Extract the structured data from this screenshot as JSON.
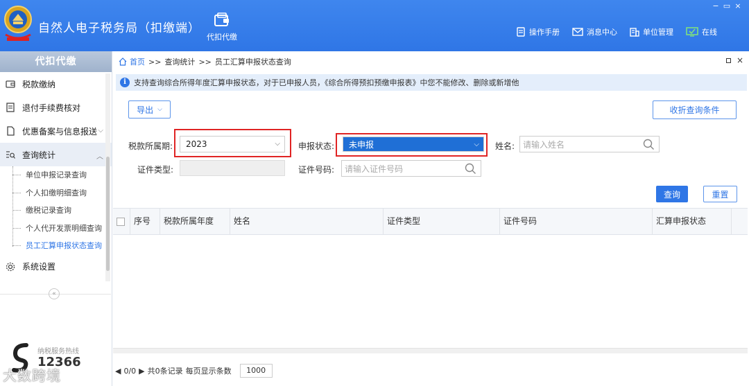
{
  "header": {
    "app_title": "自然人电子税务局（扣缴端）",
    "nav_tile": {
      "label": "代扣代缴",
      "icon": "wallet-icon"
    },
    "links": [
      {
        "label": "操作手册",
        "icon": "manual-icon"
      },
      {
        "label": "消息中心",
        "icon": "mail-icon"
      },
      {
        "label": "单位管理",
        "icon": "org-icon"
      },
      {
        "label": "在线",
        "icon": "online-monitor-icon"
      }
    ],
    "window_controls": [
      "−",
      "▭",
      "×"
    ]
  },
  "sidebar": {
    "title": "代扣代缴",
    "items": [
      {
        "label": "税款缴纳",
        "icon": "wallet-icon"
      },
      {
        "label": "退付手续费核对",
        "icon": "checklist-icon"
      },
      {
        "label": "优惠备案与信息报送",
        "icon": "document-icon"
      },
      {
        "label": "查询统计",
        "icon": "search-list-icon"
      }
    ],
    "sub_items": [
      {
        "label": "单位申报记录查询"
      },
      {
        "label": "个人扣缴明细查询"
      },
      {
        "label": "缴税记录查询"
      },
      {
        "label": "个人代开发票明细查询"
      },
      {
        "label": "员工汇算申报状态查询"
      }
    ],
    "settings": {
      "label": "系统设置",
      "icon": "gear-icon"
    },
    "collapse_glyph": "«",
    "hotline": {
      "label": "纳税服务热线",
      "number": "12366"
    },
    "watermark": "大数跨境"
  },
  "main": {
    "breadcrumb": {
      "home": "首页",
      "sep": ">>",
      "level2": "查询统计",
      "level3": "员工汇算申报状态查询"
    },
    "notice": "支持查询综合所得年度汇算申报状态，对于已申报人员，《综合所得预扣预缴申报表》中您不能修改、删除或新增他",
    "export_label": "导出",
    "collapse_label": "收折查询条件",
    "form": {
      "period_label": "税款所属期:",
      "period_value": "2023",
      "status_label": "申报状态:",
      "status_value": "未申报",
      "name_label": "姓名:",
      "name_placeholder": "请输入姓名",
      "id_type_label": "证件类型:",
      "id_number_label": "证件号码:",
      "id_number_placeholder": "请输入证件号码"
    },
    "query_label": "查询",
    "reset_label": "重置",
    "table": {
      "columns": [
        "序号",
        "税款所属年度",
        "姓名",
        "证件类型",
        "证件号码",
        "汇算申报状态"
      ],
      "rows": []
    },
    "pager": {
      "page": "0/0",
      "total": "共0条记录",
      "per_page_label": "每页显示条数",
      "per_page": "1000"
    }
  }
}
